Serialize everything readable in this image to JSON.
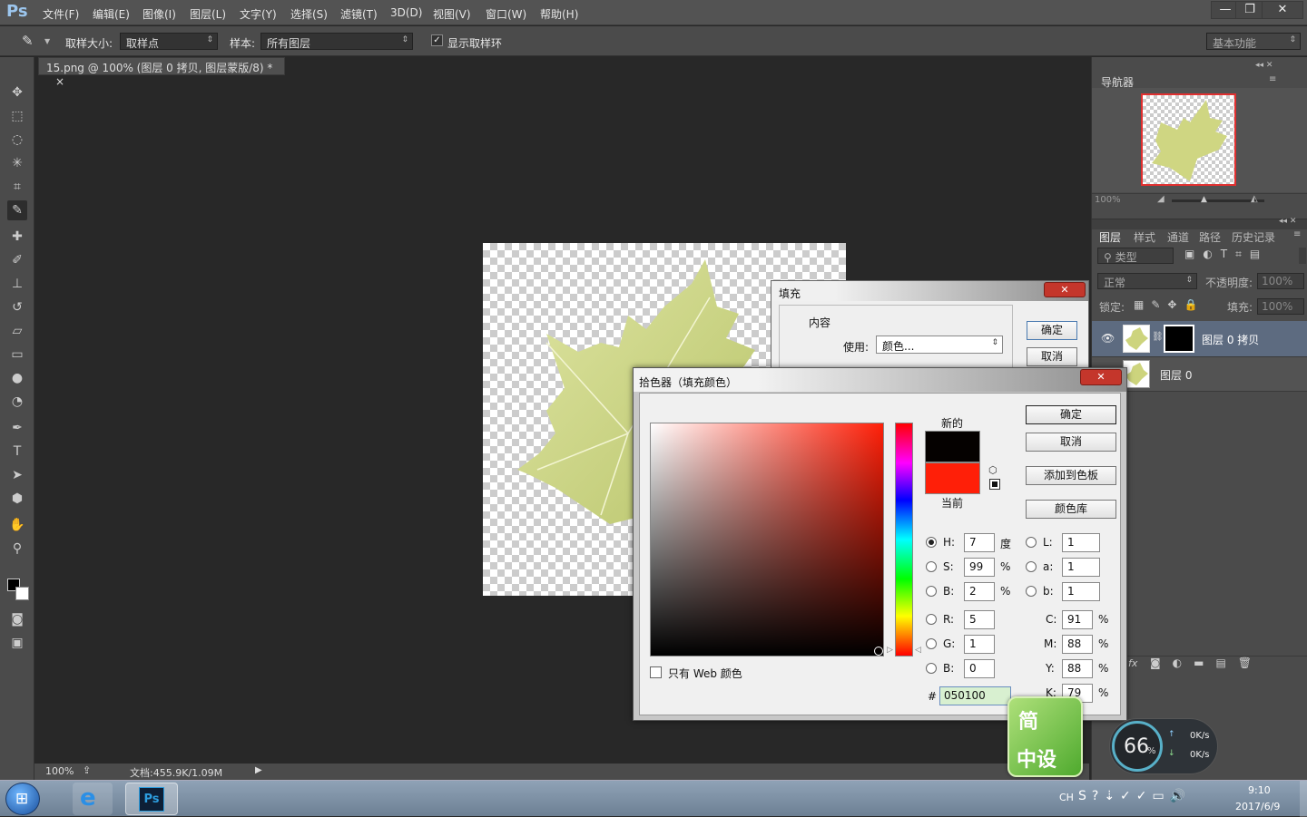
{
  "app": {
    "logo": "Ps",
    "accent": "#9cc6ee"
  },
  "menu": [
    "文件(F)",
    "编辑(E)",
    "图像(I)",
    "图层(L)",
    "文字(Y)",
    "选择(S)",
    "滤镜(T)",
    "3D(D)",
    "视图(V)",
    "窗口(W)",
    "帮助(H)"
  ],
  "window_controls": {
    "minimize": "—",
    "restore": "❐",
    "close": "✕"
  },
  "options": {
    "sample_size_label": "取样大小:",
    "sample_size_value": "取样点",
    "sample_label": "样本:",
    "sample_value": "所有图层",
    "show_ring_label": "显示取样环",
    "workspace": "基本功能"
  },
  "document": {
    "tab_title": "15.png @ 100% (图层 0 拷贝, 图层蒙版/8) *",
    "close": "×"
  },
  "status": {
    "zoom": "100%",
    "doc": "文档:455.9K/1.09M"
  },
  "navigator": {
    "title": "导航器",
    "zoom": "100%"
  },
  "layers_panel": {
    "tabs": [
      "图层",
      "样式",
      "通道",
      "路径",
      "历史记录"
    ],
    "kind_label": "类型",
    "blend_mode": "正常",
    "opacity_label": "不透明度:",
    "opacity_value": "100%",
    "lock_label": "锁定:",
    "fill_label": "填充:",
    "fill_value": "100%",
    "layers": [
      {
        "name": "图层 0 拷贝",
        "selected": true
      },
      {
        "name": "图层 0",
        "selected": false
      }
    ],
    "footer_icon": "fx"
  },
  "fill_dialog": {
    "title": "填充",
    "content_label": "内容",
    "use_label": "使用:",
    "use_value": "颜色...",
    "ok": "确定",
    "cancel": "取消"
  },
  "color_picker": {
    "title": "拾色器（填充颜色）",
    "new_label": "新的",
    "current_label": "当前",
    "new_color": "#050100",
    "current_color": "#ff1f08",
    "hue_deg": 7,
    "buttons": {
      "ok": "确定",
      "cancel": "取消",
      "add_swatch": "添加到色板",
      "libraries": "颜色库"
    },
    "web_only_label": "只有 Web 颜色",
    "fields": {
      "H": {
        "label": "H:",
        "value": "7",
        "unit": "度"
      },
      "S": {
        "label": "S:",
        "value": "99",
        "unit": "%"
      },
      "Bv": {
        "label": "B:",
        "value": "2",
        "unit": "%"
      },
      "R": {
        "label": "R:",
        "value": "5"
      },
      "G": {
        "label": "G:",
        "value": "1"
      },
      "Bl": {
        "label": "B:",
        "value": "0"
      },
      "L": {
        "label": "L:",
        "value": "1"
      },
      "a": {
        "label": "a:",
        "value": "1"
      },
      "b": {
        "label": "b:",
        "value": "1"
      },
      "C": {
        "label": "C:",
        "value": "91",
        "unit": "%"
      },
      "M": {
        "label": "M:",
        "value": "88",
        "unit": "%"
      },
      "Y": {
        "label": "Y:",
        "value": "88",
        "unit": "%"
      },
      "K": {
        "label": "K:",
        "value": "79",
        "unit": "%"
      }
    },
    "hex_label": "#",
    "hex_value": "050100"
  },
  "widgets": {
    "badge_line1": "简",
    "badge_line2": "中设",
    "speed_percent": "66",
    "speed_percent_unit": "%",
    "up_speed": "0K/s",
    "down_speed": "0K/s"
  },
  "taskbar": {
    "lang": "CH",
    "time": "9:10",
    "date": "2017/6/9",
    "ps_label": "Ps"
  }
}
